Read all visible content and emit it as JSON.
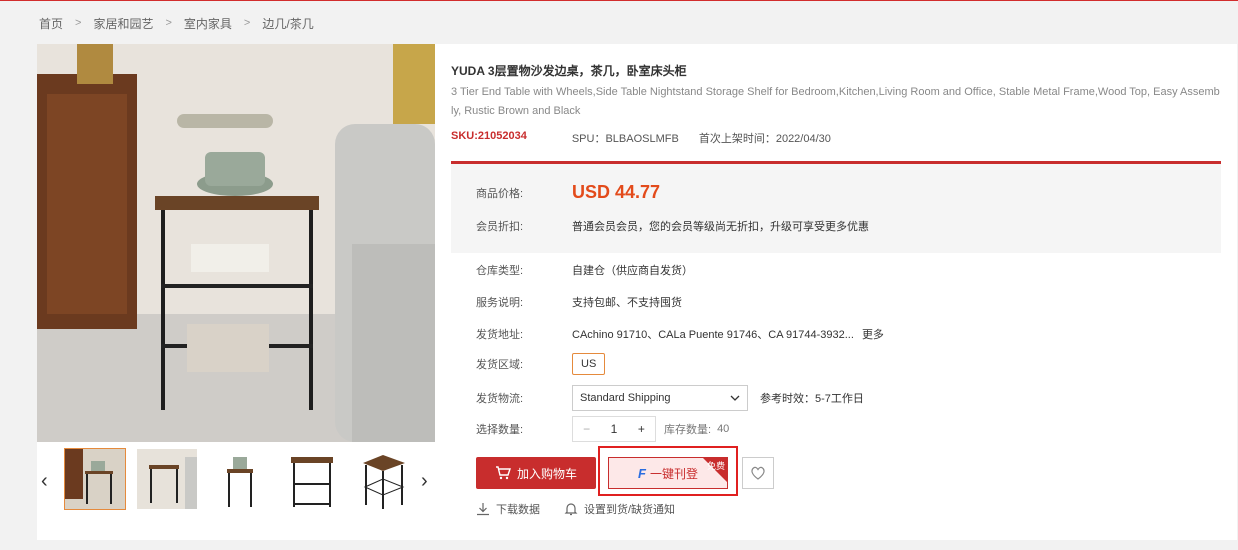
{
  "breadcrumb": [
    "首页",
    "家居和园艺",
    "室内家具",
    "边几/茶几"
  ],
  "product": {
    "title_cn": "YUDA 3层置物沙发边桌，茶几，卧室床头柜",
    "title_en": "3 Tier End Table with Wheels,Side Table Nightstand Storage Shelf for Bedroom,Kitchen,Living Room and Office, Stable Metal Frame,Wood Top, Easy Assembly, Rustic Brown and Black",
    "sku": "SKU:21052034",
    "spu": "SPU：BLBAOSLMFB",
    "listed": "首次上架时间：2022/04/30"
  },
  "price": {
    "label": "商品价格:",
    "value": "USD 44.77"
  },
  "member": {
    "label": "会员折扣:",
    "value": "普通会员会员，您的会员等级尚无折扣，升级可享受更多优惠"
  },
  "warehouse": {
    "label": "仓库类型:",
    "value": "自建仓（供应商自发货）"
  },
  "service": {
    "label": "服务说明:",
    "value": "支持包邮、不支持囤货"
  },
  "ship_from": {
    "label": "发货地址:",
    "value": "CAchino 91710、CALa Puente 91746、CA 91744-3932...",
    "more": "更多"
  },
  "ship_region": {
    "label": "发货区域:",
    "value": "US"
  },
  "logistics": {
    "label": "发货物流:",
    "selected": "Standard Shipping",
    "ref_label": "参考时效：",
    "ref_value": "5-7工作日"
  },
  "quantity": {
    "label": "选择数量:",
    "value": "1",
    "minus": "−",
    "plus": "+",
    "stock_label": "库存数量:",
    "stock_value": "40"
  },
  "actions": {
    "cart": "加入购物车",
    "onekey": "一键刊登",
    "free": "免费"
  },
  "links": {
    "download": "下载数据",
    "notify": "设置到货/缺货通知"
  },
  "nav": {
    "prev": "‹",
    "next": "›"
  },
  "colors": {
    "accent": "#c82d2d",
    "price": "#e34b1b",
    "highlight": "#e02020"
  }
}
